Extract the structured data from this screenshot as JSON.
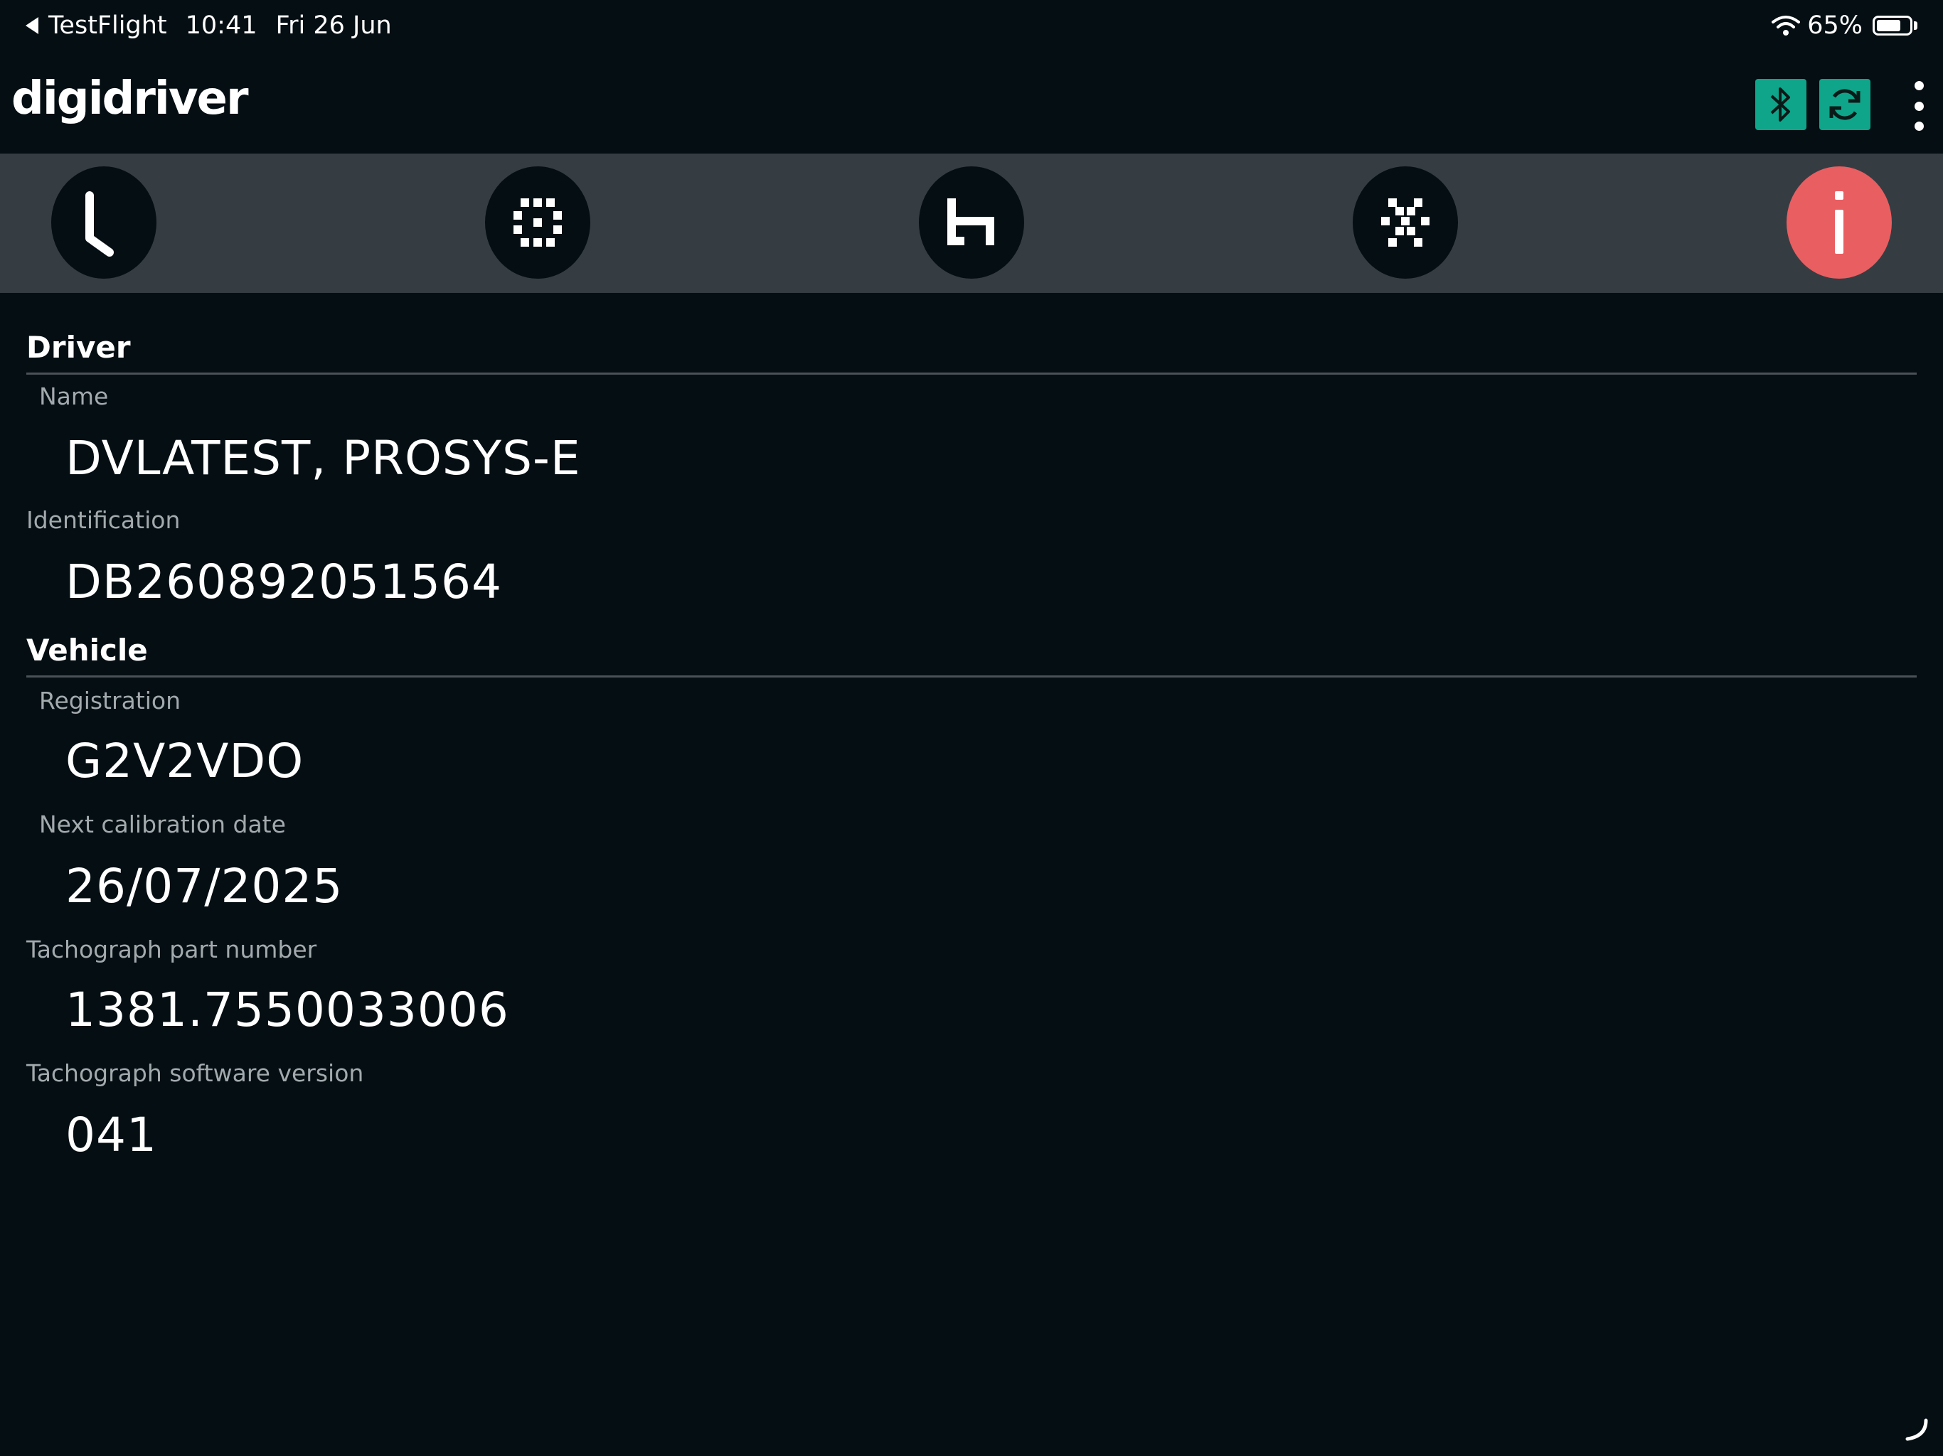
{
  "status_bar": {
    "back_app": "TestFlight",
    "time": "10:41",
    "date": "Fri 26 Jun",
    "battery": "65%",
    "battery_level": 0.65
  },
  "header": {
    "logo": "digidriver",
    "accent_color": "#0fa58a",
    "buttons": {
      "bluetooth": "bluetooth-icon",
      "sync": "sync-icon",
      "more": "more-vertical-icon"
    }
  },
  "nav": {
    "active_color": "#e95e61",
    "tabs": [
      {
        "icon": "clock-icon"
      },
      {
        "icon": "card-icon"
      },
      {
        "icon": "bed-icon"
      },
      {
        "icon": "hammer-icon"
      },
      {
        "icon": "info-icon",
        "active": true
      }
    ]
  },
  "driver": {
    "title": "Driver",
    "name_label": "Name",
    "name_value": "DVLATEST, PROSYS-E",
    "id_label": "Identification",
    "id_value": "DB260892051564"
  },
  "vehicle": {
    "title": "Vehicle",
    "registration_label": "Registration",
    "registration_value": "G2V2VDO",
    "calibration_label": "Next calibration date",
    "calibration_value": "26/07/2025",
    "part_label": "Tachograph part number",
    "part_value": "1381.7550033006",
    "software_label": "Tachograph software version",
    "software_value": "041"
  }
}
